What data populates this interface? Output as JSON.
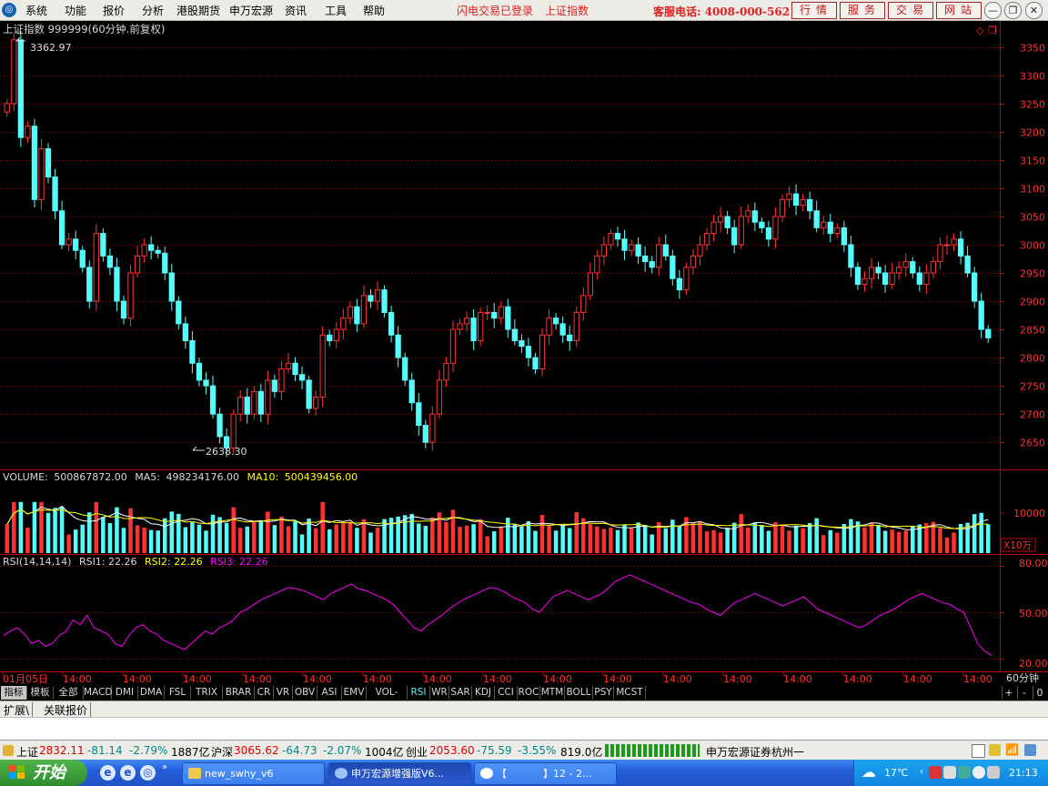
{
  "menubar": {
    "items": [
      "系统",
      "功能",
      "报价",
      "分析",
      "港股期货",
      "申万宏源",
      "资讯",
      "工具",
      "帮助"
    ],
    "notices": [
      "闪电交易已登录",
      "上证指数"
    ],
    "hotline": "客服电话: 4008-000-562",
    "buttons": [
      "行情",
      "服务",
      "交易",
      "网站"
    ]
  },
  "price_panel": {
    "title": "上证指数 999999(60分钟.前复权)",
    "high_label": "3362.97",
    "low_label": "2638.30",
    "yticks": [
      3350,
      3300,
      3250,
      3200,
      3150,
      3100,
      3050,
      3000,
      2950,
      2900,
      2850,
      2800,
      2750,
      2700,
      2650
    ],
    "ymin": 2610,
    "ymax": 3390
  },
  "volume_panel": {
    "label": "VOLUME:",
    "value": "500867872.00",
    "ma5_label": "MA5:",
    "ma5_value": "498234176.00",
    "ma10_label": "MA10:",
    "ma10_value": "500439456.00",
    "ytick": "10000",
    "unit": "X10万"
  },
  "rsi_panel": {
    "label": "RSI(14,14,14)",
    "rsi1": "RSI1: 22.26",
    "rsi2": "RSI2: 22.26",
    "rsi3": "RSI3: 22.26",
    "yticks": [
      "80.00",
      "50.00",
      "20.00"
    ]
  },
  "xaxis": {
    "labels": [
      "01月05日",
      "14:00",
      "14:00",
      "14:00",
      "14:00",
      "14:00",
      "14:00",
      "14:00",
      "14:00",
      "14:00",
      "14:00",
      "14:00",
      "14:00",
      "14:00",
      "14:00",
      "14:00",
      "14:00"
    ],
    "period": "60分钟"
  },
  "indicator_tabs": [
    "指标",
    "模板",
    "全部",
    "MACD",
    "DMI",
    "DMA",
    "FSL",
    "TRIX",
    "BRAR",
    "CR",
    "VR",
    "OBV",
    "ASI",
    "EMV",
    "VOL-TDX",
    "RSI",
    "WR",
    "SAR",
    "KDJ",
    "CCI",
    "ROC",
    "MTM",
    "BOLL",
    "PSY",
    "MCST"
  ],
  "active_tab": "RSI",
  "tab_controls": [
    "+",
    "-",
    "0"
  ],
  "ext_tabs": [
    "扩展\\",
    "关联报价"
  ],
  "statusbar": {
    "sh_name": "上证",
    "sh_price": "2832.11",
    "sh_chg": "-81.14",
    "sh_pct": "-2.79%",
    "sh_amt": "1887亿",
    "hs_name": "沪深",
    "hs_price": "3065.62",
    "hs_chg": "-64.73",
    "hs_pct": "-2.07%",
    "hs_amt": "1004亿",
    "cy_name": "创业",
    "cy_price": "2053.60",
    "cy_chg": "-75.59",
    "cy_pct": "-3.55%",
    "cy_amt": "819.0亿",
    "broker": "申万宏源证券杭州一"
  },
  "taskbar": {
    "start": "开始",
    "tasks": [
      "new_swhy_v6",
      "申万宏源增强版V6...",
      "【",
      "】12 - 2..."
    ],
    "temperature": "17℃",
    "time": "21:13"
  },
  "colors": {
    "up": "#ff3232",
    "down": "#54fcfc",
    "ma5": "#ffffff",
    "ma10": "#ffff00",
    "rsi": "#ff00ff",
    "axis": "#c00000",
    "grid": "#6a0000"
  },
  "chart_data": {
    "type": "candlestick",
    "series": [
      {
        "name": "上证指数",
        "close": [
          3250,
          3362.97,
          3190,
          3210,
          3080,
          3170,
          3120,
          3060,
          3000,
          3010,
          2990,
          2960,
          2900,
          3020,
          2980,
          2960,
          2900,
          2870,
          2950,
          2980,
          3000,
          2990,
          2985,
          2950,
          2900,
          2860,
          2830,
          2790,
          2760,
          2750,
          2700,
          2660,
          2640,
          2700,
          2730,
          2700,
          2740,
          2700,
          2760,
          2740,
          2780,
          2790,
          2770,
          2760,
          2710,
          2730,
          2840,
          2830,
          2850,
          2870,
          2890,
          2860,
          2910,
          2900,
          2920,
          2880,
          2840,
          2800,
          2760,
          2720,
          2680,
          2650,
          2700,
          2760,
          2790,
          2850,
          2860,
          2870,
          2830,
          2880,
          2880,
          2870,
          2890,
          2850,
          2830,
          2820,
          2800,
          2780,
          2840,
          2870,
          2860,
          2840,
          2830,
          2880,
          2910,
          2950,
          2980,
          3000,
          3020,
          3010,
          2990,
          3000,
          2980,
          2970,
          2960,
          3000,
          2980,
          2940,
          2920,
          2960,
          2980,
          3000,
          3020,
          3040,
          3050,
          3030,
          3000,
          3050,
          3060,
          3040,
          3030,
          3010,
          3050,
          3080,
          3090,
          3070,
          3080,
          3060,
          3030,
          3040,
          3020,
          3030,
          3000,
          2960,
          2930,
          2940,
          2960,
          2950,
          2930,
          2950,
          2960,
          2970,
          2950,
          2930,
          2950,
          2970,
          3000,
          3000,
          3010,
          2980,
          2950,
          2900,
          2850,
          2835
        ]
      }
    ],
    "volume_series": {
      "name": "VOLUME",
      "note": "per-bar volume (X10万)"
    },
    "rsi_series": {
      "name": "RSI",
      "values": [
        35,
        38,
        40,
        36,
        30,
        32,
        28,
        30,
        35,
        38,
        45,
        42,
        48,
        40,
        38,
        36,
        30,
        28,
        35,
        40,
        42,
        38,
        36,
        32,
        30,
        28,
        26,
        30,
        34,
        38,
        36,
        40,
        42,
        45,
        50,
        52,
        55,
        58,
        60,
        62,
        64,
        66,
        65,
        64,
        62,
        60,
        58,
        62,
        64,
        66,
        68,
        65,
        64,
        62,
        60,
        58,
        55,
        50,
        45,
        40,
        38,
        42,
        45,
        48,
        52,
        55,
        58,
        60,
        62,
        64,
        66,
        65,
        63,
        60,
        58,
        56,
        52,
        50,
        55,
        60,
        62,
        64,
        62,
        60,
        58,
        60,
        62,
        66,
        70,
        72,
        74,
        72,
        70,
        68,
        66,
        64,
        62,
        60,
        58,
        56,
        55,
        52,
        50,
        48,
        52,
        56,
        58,
        60,
        62,
        60,
        58,
        56,
        54,
        56,
        58,
        60,
        56,
        52,
        50,
        48,
        46,
        44,
        42,
        40,
        42,
        45,
        48,
        50,
        52,
        55,
        58,
        60,
        62,
        60,
        58,
        56,
        55,
        52,
        50,
        40,
        30,
        25,
        22.26
      ]
    }
  }
}
